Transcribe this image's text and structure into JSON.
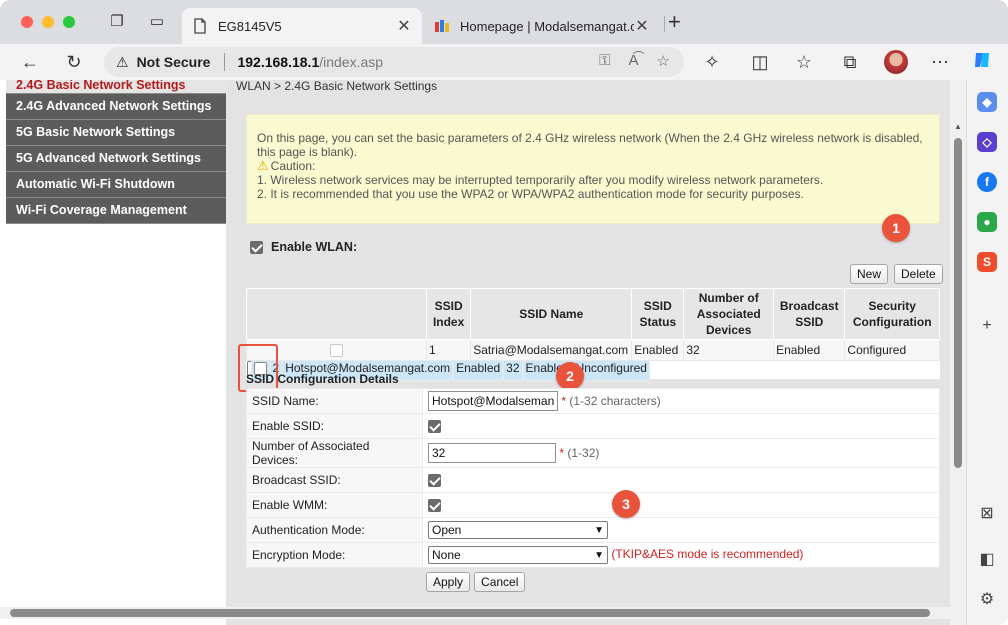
{
  "browser": {
    "tabs": [
      {
        "title": "EG8145V5",
        "active": true
      },
      {
        "title": "Homepage | Modalsemangat.c",
        "active": false
      }
    ],
    "address": {
      "security_label": "Not Secure",
      "host": "192.168.18.1",
      "path": "/index.asp"
    }
  },
  "sidebar": {
    "items": [
      {
        "label": "2.4G Basic Network Settings",
        "active": true
      },
      {
        "label": "2.4G Advanced Network Settings"
      },
      {
        "label": "5G Basic Network Settings"
      },
      {
        "label": "5G Advanced Network Settings"
      },
      {
        "label": "Automatic Wi-Fi Shutdown"
      },
      {
        "label": "Wi-Fi Coverage Management"
      }
    ]
  },
  "breadcrumb": "WLAN > 2.4G Basic Network Settings",
  "notice": {
    "intro": "On this page, you can set the basic parameters of 2.4 GHz wireless network (When the 2.4 GHz wireless network is disabled, this page is blank).",
    "caution_label": "Caution:",
    "point1": "1. Wireless network services may be interrupted temporarily after you modify wireless network parameters.",
    "point2": "2. It is recommended that you use the WPA2 or WPA/WPA2 authentication mode for security purposes."
  },
  "enable_wlan": {
    "label": "Enable WLAN:",
    "checked": true
  },
  "buttons": {
    "new": "New",
    "delete": "Delete",
    "apply": "Apply",
    "cancel": "Cancel"
  },
  "markers": [
    "1",
    "2",
    "3"
  ],
  "ssid_table": {
    "headers": [
      "SSID Index",
      "SSID Name",
      "SSID Status",
      "Number of Associated Devices",
      "Broadcast SSID",
      "Security Configuration"
    ],
    "rows": [
      {
        "index": "1",
        "name": "Satria@Modalsemangat.com",
        "status": "Enabled",
        "devices": "32",
        "broadcast": "Enabled",
        "security": "Configured"
      },
      {
        "index": "2",
        "name": "Hotspot@Modalsemangat.com",
        "status": "Enabled",
        "devices": "32",
        "broadcast": "Enabled",
        "security": "Unconfigured"
      }
    ]
  },
  "config": {
    "title": "SSID Configuration Details",
    "ssid_name": {
      "label": "SSID Name:",
      "value": "Hotspot@Modalsemangat.com",
      "hint_star": "*",
      "hint": "(1-32 characters)"
    },
    "enable_ssid": {
      "label": "Enable SSID:",
      "checked": true
    },
    "devices": {
      "label": "Number of Associated Devices:",
      "value": "32",
      "hint_star": "*",
      "hint": "(1-32)"
    },
    "broadcast": {
      "label": "Broadcast SSID:",
      "checked": true
    },
    "wmm": {
      "label": "Enable WMM:",
      "checked": true
    },
    "auth": {
      "label": "Authentication Mode:",
      "value": "Open"
    },
    "encryption": {
      "label": "Encryption Mode:",
      "value": "None",
      "hint": "(TKIP&AES mode is recommended)"
    }
  }
}
